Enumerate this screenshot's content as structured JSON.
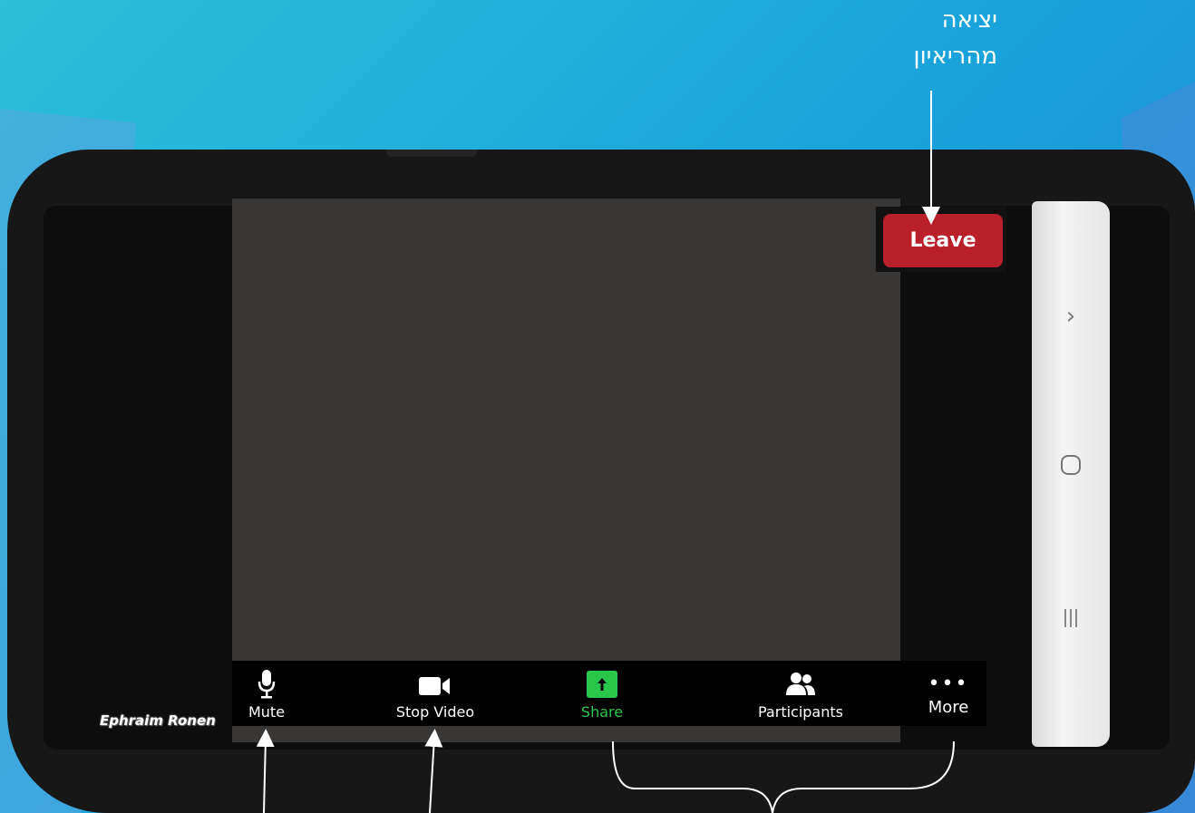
{
  "annotation": {
    "leave_caption_line1": "יציאה",
    "leave_caption_line2": "מהריאיון"
  },
  "meeting": {
    "leave_label": "Leave",
    "participant_name": "Ephraim Ronen"
  },
  "toolbar": {
    "items": [
      {
        "label": "Mute",
        "icon": "microphone-icon"
      },
      {
        "label": "Stop Video",
        "icon": "video-camera-icon"
      },
      {
        "label": "Share",
        "icon": "share-upload-icon",
        "color": "#28c64a"
      },
      {
        "label": "Participants",
        "icon": "participants-icon"
      },
      {
        "label": "More",
        "icon": "ellipsis-icon"
      }
    ]
  },
  "system_nav": {
    "icons": [
      "chevron-right-icon",
      "home-circle-icon",
      "recent-apps-icon"
    ]
  },
  "colors": {
    "leave": "#b9202a",
    "share": "#28c64a",
    "background": "#1aa3da"
  }
}
